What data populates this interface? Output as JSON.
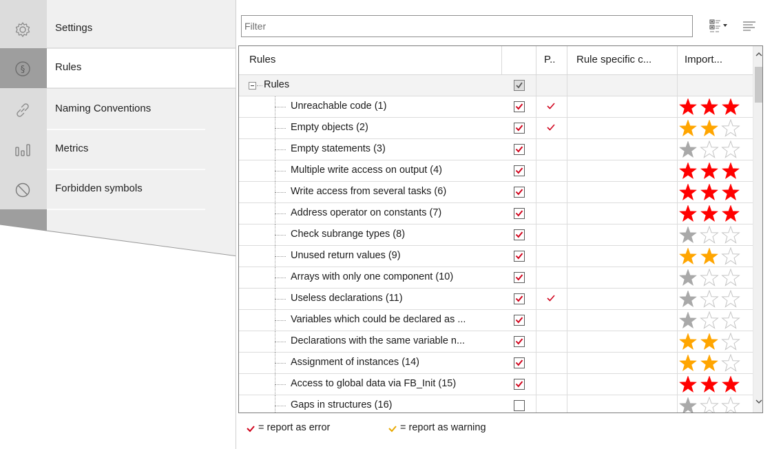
{
  "nav": {
    "items": [
      {
        "label": "Settings",
        "icon": "gear-icon"
      },
      {
        "label": "Rules",
        "icon": "section-sign-icon"
      },
      {
        "label": "Naming Conventions",
        "icon": "link-icon"
      },
      {
        "label": "Metrics",
        "icon": "bar-chart-icon"
      },
      {
        "label": "Forbidden symbols",
        "icon": "no-entry-icon"
      }
    ],
    "selected": "Rules"
  },
  "filter": {
    "placeholder": "Filter",
    "value": ""
  },
  "toolbar": {
    "view_options_icon": "list-view-options-icon",
    "sort_icon": "sort-lines-icon"
  },
  "grid": {
    "columns": [
      "Rules",
      "",
      "P..",
      "Rule specific c...",
      "Import..."
    ],
    "group": {
      "label": "Rules",
      "checked": "partial"
    },
    "rows": [
      {
        "name": "Unreachable code (1)",
        "checked": true,
        "p": true,
        "importance": 3
      },
      {
        "name": "Empty objects (2)",
        "checked": true,
        "p": true,
        "importance": 2
      },
      {
        "name": "Empty statements (3)",
        "checked": true,
        "p": false,
        "importance": 1
      },
      {
        "name": "Multiple write access on output (4)",
        "checked": true,
        "p": false,
        "importance": 3
      },
      {
        "name": "Write access from several tasks (6)",
        "checked": true,
        "p": false,
        "importance": 3
      },
      {
        "name": "Address operator on constants (7)",
        "checked": true,
        "p": false,
        "importance": 3
      },
      {
        "name": "Check subrange types (8)",
        "checked": true,
        "p": false,
        "importance": 1
      },
      {
        "name": "Unused return values  (9)",
        "checked": true,
        "p": false,
        "importance": 2
      },
      {
        "name": "Arrays with only one component (10)",
        "checked": true,
        "p": false,
        "importance": 1
      },
      {
        "name": "Useless declarations (11)",
        "checked": true,
        "p": true,
        "importance": 1
      },
      {
        "name": "Variables which could be declared as ...",
        "checked": true,
        "p": false,
        "importance": 1
      },
      {
        "name": "Declarations with the same variable n...",
        "checked": true,
        "p": false,
        "importance": 2
      },
      {
        "name": "Assignment of instances (14)",
        "checked": true,
        "p": false,
        "importance": 2
      },
      {
        "name": "Access to global data via  FB_Init (15)",
        "checked": true,
        "p": false,
        "importance": 3
      },
      {
        "name": "Gaps in structures (16)",
        "checked": false,
        "p": false,
        "importance": 1
      }
    ]
  },
  "legend": {
    "error_label": "= report as error",
    "warning_label": "= report as warning"
  },
  "colors": {
    "error": "#d0021b",
    "warning": "#e8a800",
    "star_red": "#ff0000",
    "star_orange": "#ffa500",
    "star_grey": "#a9a9a9",
    "nav_selected_bg": "#ffffff",
    "nav_bg": "#f0f0f0",
    "nav_icon_strip": "#dcdcdc",
    "nav_icon_strip_selected": "#9e9e9e"
  }
}
